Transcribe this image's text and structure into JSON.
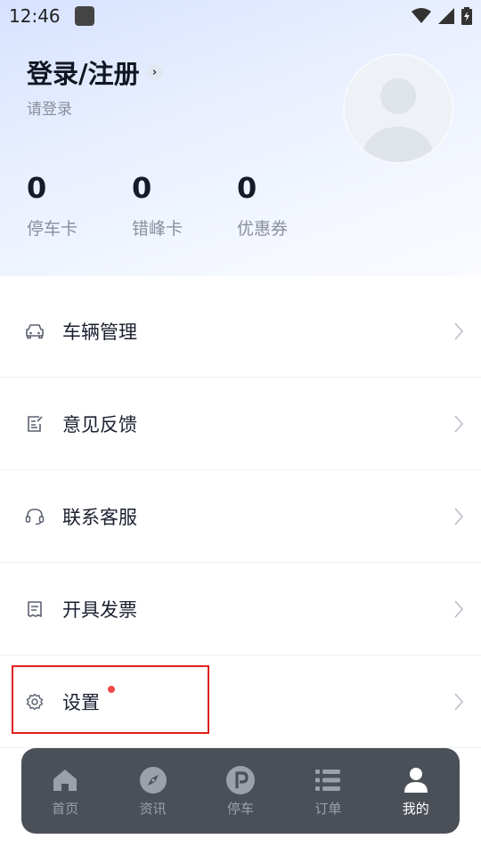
{
  "status_bar": {
    "time": "12:46"
  },
  "profile": {
    "title": "登录/注册",
    "subtitle": "请登录"
  },
  "stats": [
    {
      "value": "0",
      "label": "停车卡"
    },
    {
      "value": "0",
      "label": "错峰卡"
    },
    {
      "value": "0",
      "label": "优惠券"
    }
  ],
  "menu": [
    {
      "label": "车辆管理",
      "icon": "car-icon"
    },
    {
      "label": "意见反馈",
      "icon": "feedback-icon"
    },
    {
      "label": "联系客服",
      "icon": "headset-icon"
    },
    {
      "label": "开具发票",
      "icon": "invoice-icon"
    },
    {
      "label": "设置",
      "icon": "gear-icon",
      "badge": "red-dot"
    }
  ],
  "tabbar": [
    {
      "label": "首页",
      "icon": "home-icon",
      "active": false
    },
    {
      "label": "资讯",
      "icon": "compass-icon",
      "active": false
    },
    {
      "label": "停车",
      "icon": "parking-icon",
      "active": false
    },
    {
      "label": "订单",
      "icon": "list-icon",
      "active": false
    },
    {
      "label": "我的",
      "icon": "person-icon",
      "active": true
    }
  ],
  "colors": {
    "tabbar_bg": "#4b5058",
    "badge_red": "#f04848",
    "highlight_red": "#e0201e",
    "hero_gradient_start": "#d6e2ff"
  }
}
